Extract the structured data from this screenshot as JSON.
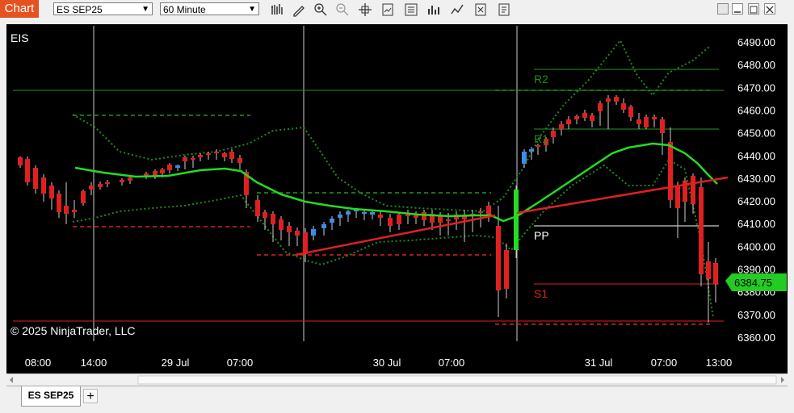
{
  "app": {
    "badge": "Chart"
  },
  "toolbar": {
    "instrument": "ES SEP25",
    "interval": "60 Minute",
    "icons": [
      "bar-type-icon",
      "draw-tool-icon",
      "zoom-in-icon",
      "zoom-out-icon",
      "crosshair-icon",
      "chart-style-icon",
      "data-box-icon",
      "indicators-icon",
      "strategies-icon",
      "properties-icon",
      "templates-icon"
    ]
  },
  "chart": {
    "instrument_label": "EIS",
    "copyright": "© 2025 NinjaTrader, LLC",
    "price_axis": [
      "6490.00",
      "6480.00",
      "6470.00",
      "6460.00",
      "6450.00",
      "6440.00",
      "6430.00",
      "6420.00",
      "6410.00",
      "6400.00",
      "6390.00",
      "6380.00",
      "6370.00",
      "6360.00"
    ],
    "time_axis": [
      "08:00",
      "14:00",
      "29 Jul",
      "07:00",
      "30 Jul",
      "07:00",
      "31 Jul",
      "07:00",
      "13:00"
    ],
    "last_price": "6384.75",
    "pivot_labels": {
      "r2": "R2",
      "r1": "R1",
      "pp": "PP",
      "s1": "S1"
    },
    "colors": {
      "up": "#3d8ce6",
      "down": "#e02020",
      "ma": "#22dd22",
      "bands": "#1f8a1f",
      "trend": "#e02020",
      "last_price_bg": "#22cc22"
    }
  },
  "tabs": {
    "active": "ES SEP25",
    "add": "+"
  }
}
